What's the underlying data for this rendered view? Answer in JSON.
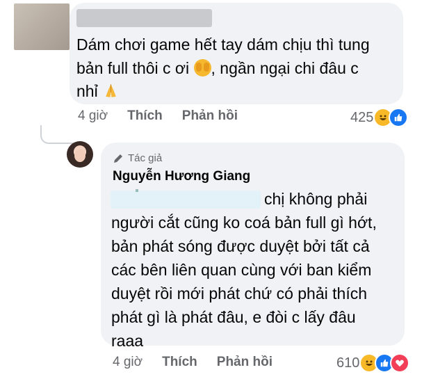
{
  "comment1": {
    "text_line1": "Dám chơi game hết tay dám chịu thì tung",
    "text_line2_before_emoji": "bản full thôi c ơi ",
    "text_line2_after_emoji": ", ngần ngại chi đâu c",
    "text_line3": "nhỉ ",
    "time": "4 giờ",
    "like_label": "Thích",
    "reply_label": "Phản hồi",
    "reaction_count": "425"
  },
  "reply": {
    "author_badge": "Tác giả",
    "author_name": "Nguyễn Hương Giang",
    "text": "chị không phải\nngười cắt cũng ko coá bản full gì hớt,\nbản phát sóng được duyệt bởi tất cả\ncác bên liên quan cùng với ban kiểm\nduyệt rồi mới phát chứ có phải thích\nphát gì là phát đâu, e đòi c lấy đâu\nraaa",
    "time": "4 giờ",
    "like_label": "Thích",
    "reply_label": "Phản hồi",
    "reaction_count": "610"
  },
  "icons": {
    "reactions1": [
      "haha-icon",
      "like-icon"
    ],
    "reactions2": [
      "haha-icon",
      "like-icon",
      "love-icon"
    ]
  },
  "colors": {
    "bubble_bg": "#f0f2f5",
    "meta_text": "#65676b",
    "like_blue": "#1877f2",
    "haha_yellow": "#f7b928",
    "love_red": "#f33e58"
  }
}
